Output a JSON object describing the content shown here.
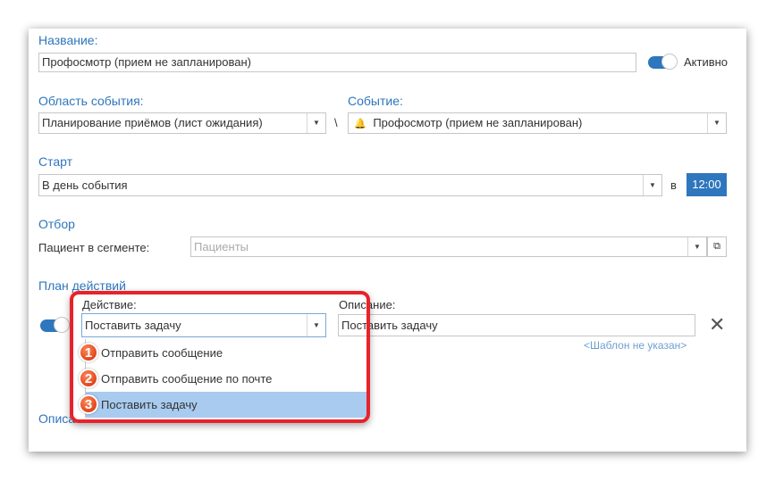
{
  "name": {
    "label": "Название:",
    "value": "Профосмотр (прием не запланирован)",
    "active_label": "Активно"
  },
  "event_area": {
    "label": "Область события:",
    "value": "Планирование приёмов (лист ожидания)"
  },
  "separator": "\\",
  "event": {
    "label": "Событие:",
    "value": "Профосмотр (прием не запланирован)"
  },
  "start": {
    "label": "Старт",
    "value": "В день события",
    "at_label": "в",
    "time": "12:00"
  },
  "filter": {
    "label": "Отбор",
    "segment_label": "Пациент в сегменте:",
    "segment_placeholder": "Пациенты"
  },
  "plan": {
    "label": "План действий",
    "action_label": "Действие:",
    "action_value": "Поставить задачу",
    "description_label": "Описание:",
    "description_value": "Поставить задачу",
    "template_link": "<Шаблон не указан>",
    "options": [
      {
        "badge": "1",
        "label": "Отправить сообщение"
      },
      {
        "badge": "2",
        "label": "Отправить сообщение по почте"
      },
      {
        "badge": "3",
        "label": "Поставить задачу"
      }
    ]
  },
  "description_section": {
    "label": "Описа"
  },
  "colors": {
    "accent": "#2e76bd",
    "highlight": "#e8222b",
    "selected_row": "#a8cbef"
  }
}
